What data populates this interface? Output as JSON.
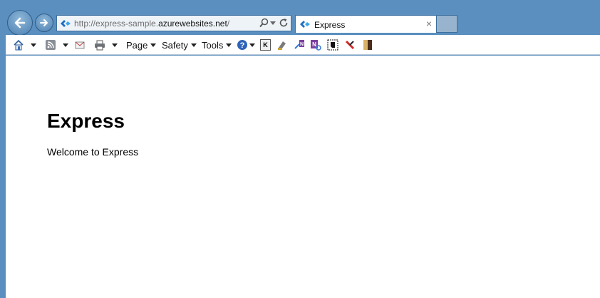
{
  "address_bar": {
    "url_prefix": "http://express-sample.",
    "url_domain": "azurewebsites.net",
    "url_suffix": "/"
  },
  "tab": {
    "title": "Express",
    "close": "×"
  },
  "command_bar": {
    "page": "Page",
    "safety": "Safety",
    "tools": "Tools",
    "k_label": "K",
    "nb_label": "N"
  },
  "page": {
    "heading": "Express",
    "text": "Welcome to Express"
  },
  "colors": {
    "frame": "#5a8fbf",
    "tab_active": "#ffffff"
  }
}
